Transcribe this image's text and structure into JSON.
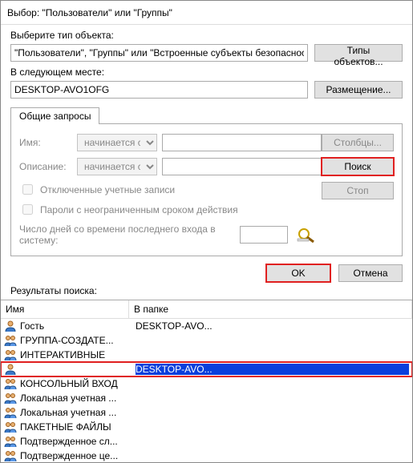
{
  "window": {
    "title": "Выбор: \"Пользователи\" или \"Группы\""
  },
  "object_type": {
    "label": "Выберите тип объекта:",
    "value": "\"Пользователи\", \"Группы\" или \"Встроенные субъекты безопасности\"",
    "button": "Типы объектов..."
  },
  "location": {
    "label": "В следующем месте:",
    "value": "DESKTOP-AVO1OFG",
    "button": "Размещение..."
  },
  "tabs": {
    "common_queries": "Общие запросы"
  },
  "query": {
    "name_label": "Имя:",
    "name_mode": "начинается с",
    "name_value": "",
    "desc_label": "Описание:",
    "desc_mode": "начинается с",
    "desc_value": "",
    "chk_disabled": "Отключенные учетные записи",
    "chk_nopwdexp": "Пароли с неограниченным сроком действия",
    "days_label": "Число дней со времени последнего входа в систему:",
    "columns_btn": "Столбцы...",
    "search_btn": "Поиск",
    "stop_btn": "Стоп"
  },
  "buttons": {
    "ok": "OK",
    "cancel": "Отмена"
  },
  "results": {
    "label": "Результаты поиска:",
    "columns": {
      "name": "Имя",
      "folder": "В папке"
    },
    "rows": [
      {
        "icon": "user",
        "name": "Гость",
        "folder": "DESKTOP-AVO..."
      },
      {
        "icon": "group",
        "name": "ГРУППА-СОЗДАТЕ...",
        "folder": ""
      },
      {
        "icon": "group",
        "name": "ИНТЕРАКТИВНЫЕ",
        "folder": ""
      },
      {
        "icon": "user",
        "name": " ",
        "folder": "DESKTOP-AVO...",
        "selected": true,
        "highlight": true
      },
      {
        "icon": "group",
        "name": "КОНСОЛЬНЫЙ ВХОД",
        "folder": ""
      },
      {
        "icon": "group",
        "name": "Локальная учетная ...",
        "folder": ""
      },
      {
        "icon": "group",
        "name": "Локальная учетная ...",
        "folder": ""
      },
      {
        "icon": "group",
        "name": "ПАКЕТНЫЕ ФАЙЛЫ",
        "folder": ""
      },
      {
        "icon": "group",
        "name": "Подтвержденное сл...",
        "folder": ""
      },
      {
        "icon": "group",
        "name": "Подтвержденное це...",
        "folder": ""
      }
    ]
  }
}
